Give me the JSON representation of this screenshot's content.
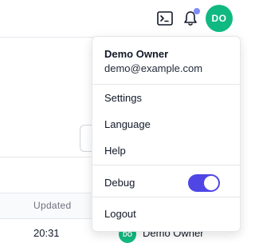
{
  "header": {
    "terminal_icon": "terminal-icon",
    "bell_icon": "bell-icon",
    "notification_color": "#818cf8",
    "avatar_initials": "DO",
    "avatar_color": "#10b981"
  },
  "background": {
    "column_updated": "Updated",
    "row_time": "20:31",
    "row_owner": "Demo Owner",
    "row_owner_initials": "DO"
  },
  "user_menu": {
    "name": "Demo Owner",
    "email": "demo@example.com",
    "items": {
      "settings": "Settings",
      "language": "Language",
      "help": "Help",
      "debug": "Debug",
      "logout": "Logout"
    },
    "debug_enabled": true,
    "toggle_color": "#4f46e5"
  }
}
